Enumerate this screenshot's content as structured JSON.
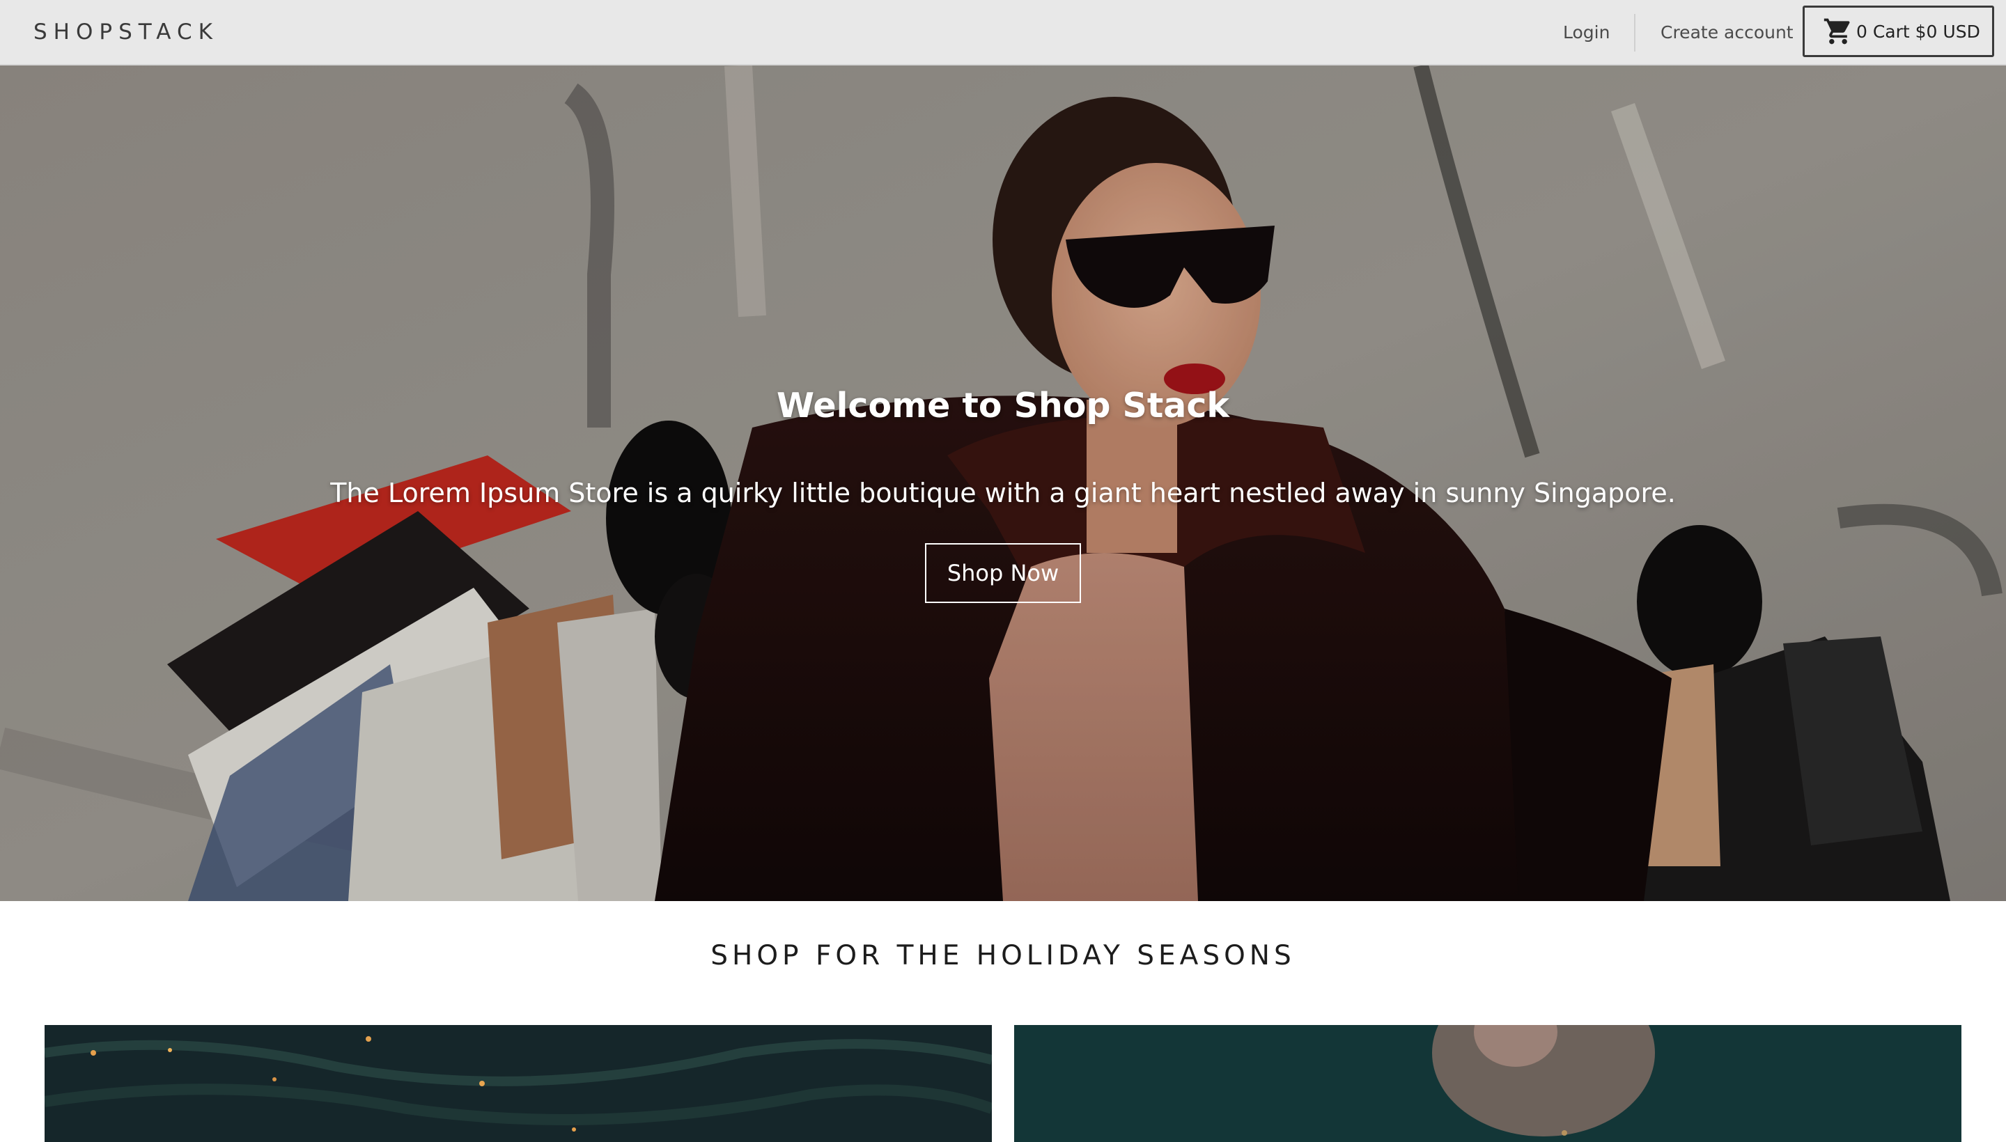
{
  "header": {
    "logo": "SHOPSTACK",
    "login_label": "Login",
    "create_account_label": "Create account",
    "cart_label": "0 Cart $0 USD",
    "cart_icon": "shopping-cart-icon"
  },
  "hero": {
    "title": "Welcome to Shop Stack",
    "subtitle": "The Lorem Ipsum Store is a quirky little boutique with a giant heart nestled away in sunny Singapore.",
    "button_label": "Shop Now"
  },
  "section": {
    "title": "SHOP FOR THE HOLIDAY SEASONS"
  },
  "colors": {
    "header_bg": "#e8e8e8",
    "text_dark": "#1c1c1c",
    "hero_text": "#ffffff"
  }
}
